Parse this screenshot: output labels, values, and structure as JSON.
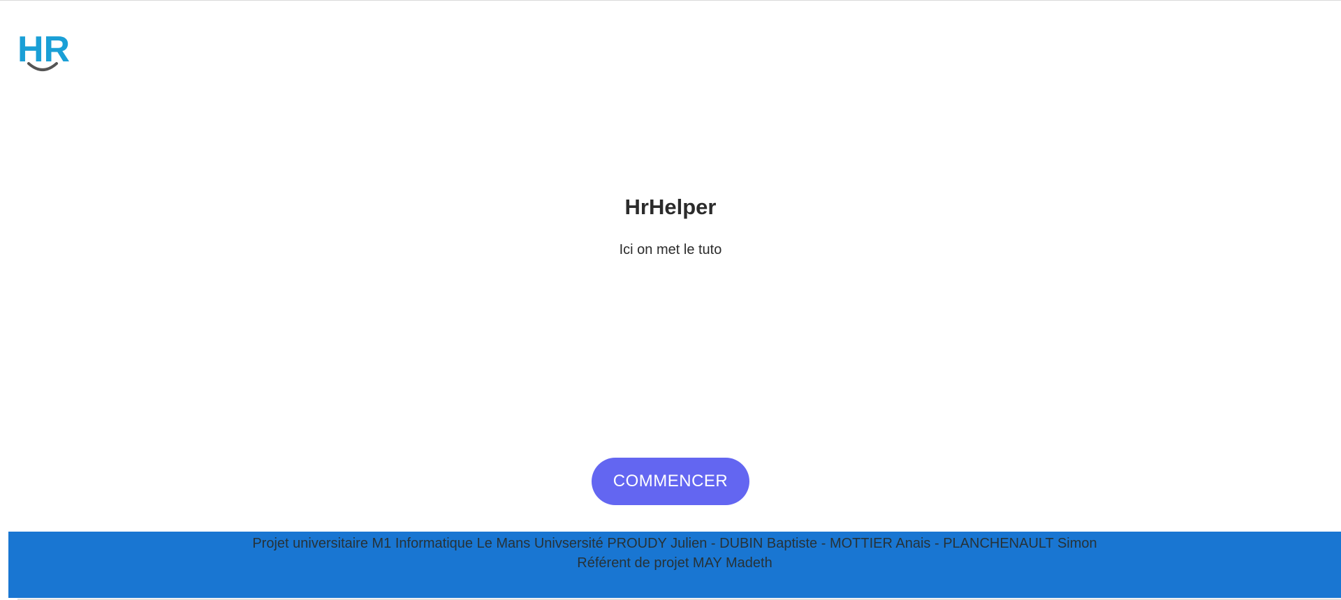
{
  "logo": {
    "text": "HR",
    "color": "#1a9fd6",
    "smile_color": "#555555"
  },
  "main": {
    "title": "HrHelper",
    "subtitle": "Ici on met le tuto",
    "start_button_label": "COMMENCER",
    "button_color": "#6366f1"
  },
  "footer": {
    "line1": "Projet universitaire M1 Informatique Le Mans Univsersité PROUDY Julien - DUBIN Baptiste - MOTTIER Anais - PLANCHENAULT Simon",
    "line2": "Référent de projet MAY Madeth",
    "background_color": "#1976d2"
  }
}
